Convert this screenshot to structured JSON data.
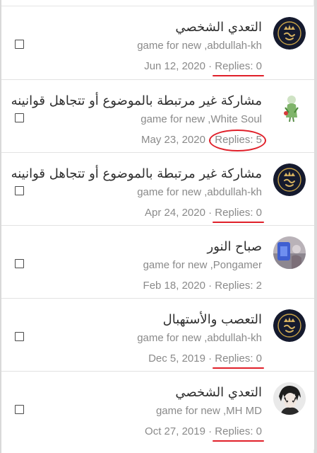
{
  "topics": [
    {
      "title": "التعدي الشخصي",
      "author": "game for new ,abdullah-kh",
      "date": "Jun 12, 2020",
      "separator": "·",
      "replies": "Replies: 0",
      "avatar": "crown-emblem-avatar",
      "replies_mark": "underline"
    },
    {
      "title": "مشاركة غير مرتبطة بالموضوع أو تتجاهل قوانينه",
      "author": "game for new ,White Soul",
      "date": "May 23, 2020",
      "separator": "·",
      "replies": "Replies: 5",
      "avatar": "green-figure-avatar",
      "replies_mark": "circle"
    },
    {
      "title": "مشاركة غير مرتبطة بالموضوع أو تتجاهل قوانينه",
      "author": "game for new ,abdullah-kh",
      "date": "Apr 24, 2020",
      "separator": "·",
      "replies": "Replies: 0",
      "avatar": "crown-emblem-avatar",
      "replies_mark": "underline"
    },
    {
      "title": "صباح النور",
      "author": "game for new ,Pongamer",
      "date": "Feb 18, 2020",
      "separator": "·",
      "replies": "Replies: 2",
      "avatar": "blue-photo-avatar",
      "replies_mark": "none"
    },
    {
      "title": "التعصب والأستهبال",
      "author": "game for new ,abdullah-kh",
      "date": "Dec 5, 2019",
      "separator": "·",
      "replies": "Replies: 0",
      "avatar": "crown-emblem-avatar",
      "replies_mark": "underline"
    },
    {
      "title": "التعدي الشخصي",
      "author": "game for new ,MH MD",
      "date": "Oct 27, 2019",
      "separator": "·",
      "replies": "Replies: 0",
      "avatar": "anime-character-avatar",
      "replies_mark": "underline"
    }
  ],
  "colors": {
    "annotation_red": "#e0202a",
    "text_primary": "#2e2e2e",
    "text_secondary": "#8a8a8a",
    "divider": "#e2e2e2"
  }
}
